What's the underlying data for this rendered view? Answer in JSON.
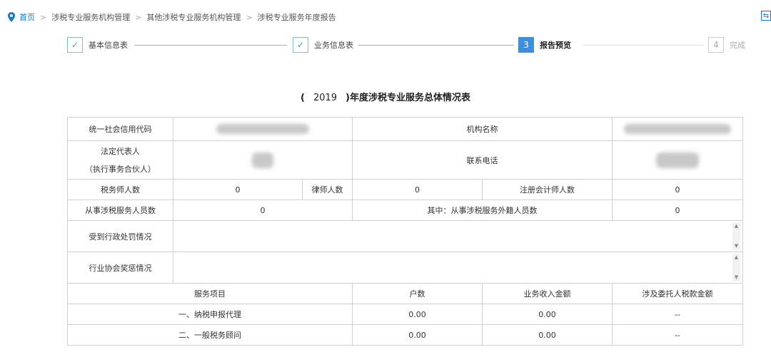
{
  "breadcrumb": {
    "home": "首页",
    "items": [
      "涉税专业服务机构管理",
      "其他涉税专业服务机构管理",
      "涉税专业服务年度报告"
    ]
  },
  "steps": [
    {
      "num": "✓",
      "label": "基本信息表",
      "state": "done"
    },
    {
      "num": "✓",
      "label": "业务信息表",
      "state": "done"
    },
    {
      "num": "3",
      "label": "报告预览",
      "state": "active"
    },
    {
      "num": "4",
      "label": "完成",
      "state": "todo"
    }
  ],
  "report": {
    "title_open": "(",
    "year": "2019",
    "title_rest": ")年度涉税专业服务总体情况表",
    "credit_code_label": "统一社会信用代码",
    "org_name_label": "机构名称",
    "legal_rep_label_1": "法定代表人",
    "legal_rep_label_2": "（执行事务合伙人）",
    "phone_label": "联系电话",
    "tax_agents_label": "税务师人数",
    "tax_agents_value": "0",
    "lawyers_label": "律师人数",
    "lawyers_value": "0",
    "cpa_label": "注册会计师人数",
    "cpa_value": "0",
    "staff_label": "从事涉税服务人员数",
    "staff_value": "0",
    "foreign_staff_label": "其中：从事涉税服务外籍人员数",
    "foreign_staff_value": "0",
    "penalty_label": "受到行政处罚情况",
    "award_label": "行业协会奖惩情况",
    "col_service": "服务项目",
    "col_households": "户数",
    "col_income": "业务收入金额",
    "col_tax": "涉及委托人税款金额",
    "rows": [
      {
        "name": "一、纳税申报代理",
        "households": "0.00",
        "income": "0.00",
        "tax": "--"
      },
      {
        "name": "二、一般税务顾问",
        "households": "0.00",
        "income": "0.00",
        "tax": "--"
      }
    ]
  },
  "colors": {
    "accent": "#3d8fde",
    "link": "#1677d2"
  }
}
